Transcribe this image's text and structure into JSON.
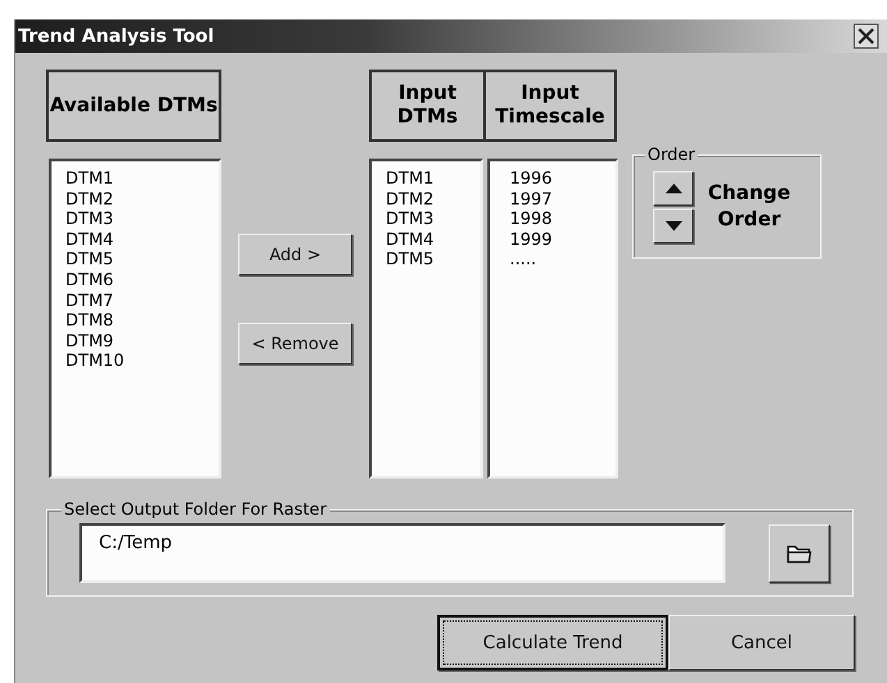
{
  "window": {
    "title": "Trend Analysis Tool"
  },
  "available": {
    "heading": "Available DTMs",
    "items": [
      "DTM1",
      "DTM2",
      "DTM3",
      "DTM4",
      "DTM5",
      "DTM6",
      "DTM7",
      "DTM8",
      "DTM9",
      "DTM10"
    ]
  },
  "transfer_buttons": [
    "Add >",
    "< Remove"
  ],
  "input_dtms": {
    "heading": "Input DTMs",
    "items": [
      "DTM1",
      "DTM2",
      "DTM3",
      "DTM4",
      "DTM5"
    ]
  },
  "input_timescale": {
    "heading": "Input Timescale",
    "items": [
      "1996",
      "1997",
      "1998",
      "1999",
      "....."
    ]
  },
  "order": {
    "legend": "Order",
    "label": "Change Order"
  },
  "output": {
    "legend": "Select Output Folder For Raster",
    "value": "C:/Temp"
  },
  "footer_buttons": [
    {
      "label": "Calculate Trend",
      "focused": true
    },
    {
      "label": "Cancel",
      "focused": false
    }
  ]
}
